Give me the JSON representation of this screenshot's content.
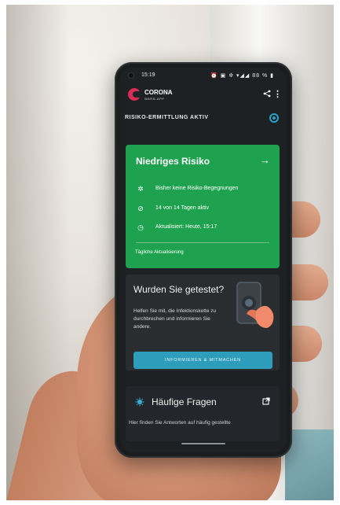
{
  "statusbar": {
    "time": "15:19",
    "icons": "⏰ ▣ ✲ ▾◢◢ 88 % ▮"
  },
  "app": {
    "name": "CORONA",
    "subtitle": "WARN-APP"
  },
  "tracing": {
    "label": "RISIKO-ERMITTLUNG AKTIV"
  },
  "risk_card": {
    "title": "Niedriges Risiko",
    "arrow": "→",
    "rows": [
      {
        "icon": "virus-icon",
        "text": "Bisher keine Risiko-Begegnungen"
      },
      {
        "icon": "check-circle-icon",
        "text": "14 von 14 Tagen aktiv"
      },
      {
        "icon": "refresh-clock-icon",
        "text": "Aktualisiert: Heute, 15:17"
      }
    ],
    "footer": "Tägliche Aktualisierung"
  },
  "test_card": {
    "title": "Wurden Sie getestet?",
    "body": "Helfen Sie mit, die Infektionskette zu durchbrechen und informieren Sie andere.",
    "button": "INFORMIEREN & MITMACHEN"
  },
  "faq_card": {
    "title": "Häufige Fragen",
    "text": "Hier finden Sie Antworten auf häufig gestellte"
  },
  "colors": {
    "risk_green": "#1fa24f",
    "accent_blue": "#2e9dbc",
    "brand_red": "#d92c55"
  }
}
